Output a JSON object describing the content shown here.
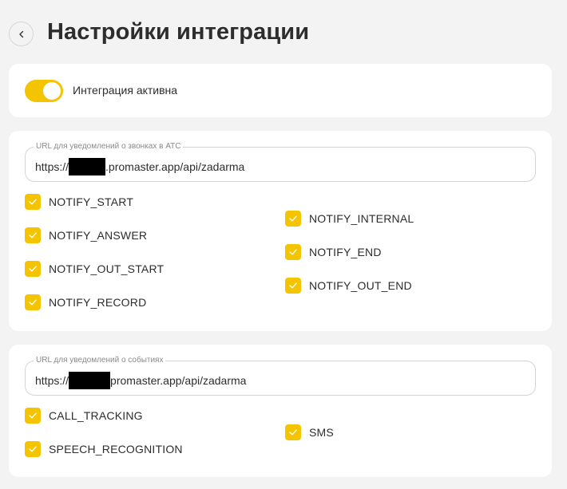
{
  "header": {
    "title": "Настройки интеграции"
  },
  "integration": {
    "active_label": "Интеграция активна",
    "active": true
  },
  "atc": {
    "field_label": "URL для уведомлений о звонках в АТС",
    "url_prefix": "https://",
    "url_suffix": ".promaster.app/api/zadarma",
    "options": [
      {
        "label": "NOTIFY_START",
        "checked": true
      },
      {
        "label": "NOTIFY_ANSWER",
        "checked": true
      },
      {
        "label": "NOTIFY_OUT_START",
        "checked": true
      },
      {
        "label": "NOTIFY_RECORD",
        "checked": true
      },
      {
        "label": "NOTIFY_INTERNAL",
        "checked": true
      },
      {
        "label": "NOTIFY_END",
        "checked": true
      },
      {
        "label": "NOTIFY_OUT_END",
        "checked": true
      }
    ]
  },
  "events": {
    "field_label": "URL для уведомлений о событиях",
    "url_prefix": "https://",
    "url_suffix": "promaster.app/api/zadarma",
    "options": [
      {
        "label": "CALL_TRACKING",
        "checked": true
      },
      {
        "label": "SPEECH_RECOGNITION",
        "checked": true
      },
      {
        "label": "SMS",
        "checked": true
      }
    ]
  },
  "colors": {
    "accent": "#f5c400",
    "background": "#f3f3f4",
    "card": "#ffffff"
  }
}
